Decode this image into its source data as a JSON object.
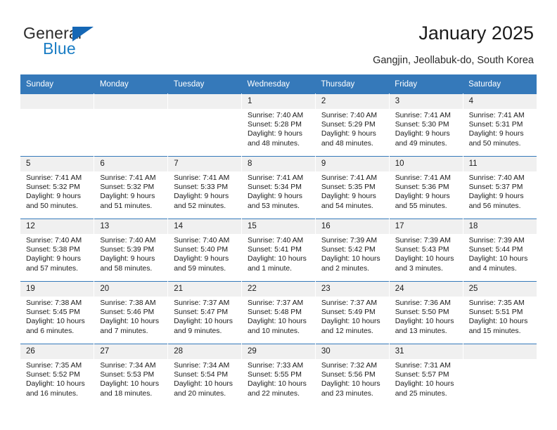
{
  "brand": {
    "name_part1": "General",
    "name_part2": "Blue",
    "triangle_color": "#1567b5",
    "blue_text_color": "#1a7dc4"
  },
  "header": {
    "title": "January 2025",
    "location": "Gangjin, Jeollabuk-do, South Korea"
  },
  "theme": {
    "header_row_bg": "#3579ba",
    "daynum_bg": "#f0f0f0",
    "grid_line": "#3579ba"
  },
  "weekdays": [
    "Sunday",
    "Monday",
    "Tuesday",
    "Wednesday",
    "Thursday",
    "Friday",
    "Saturday"
  ],
  "weeks": [
    [
      {
        "day": "",
        "empty": true
      },
      {
        "day": "",
        "empty": true
      },
      {
        "day": "",
        "empty": true
      },
      {
        "day": "1",
        "sunrise": "Sunrise: 7:40 AM",
        "sunset": "Sunset: 5:28 PM",
        "daylight1": "Daylight: 9 hours",
        "daylight2": "and 48 minutes."
      },
      {
        "day": "2",
        "sunrise": "Sunrise: 7:40 AM",
        "sunset": "Sunset: 5:29 PM",
        "daylight1": "Daylight: 9 hours",
        "daylight2": "and 48 minutes."
      },
      {
        "day": "3",
        "sunrise": "Sunrise: 7:41 AM",
        "sunset": "Sunset: 5:30 PM",
        "daylight1": "Daylight: 9 hours",
        "daylight2": "and 49 minutes."
      },
      {
        "day": "4",
        "sunrise": "Sunrise: 7:41 AM",
        "sunset": "Sunset: 5:31 PM",
        "daylight1": "Daylight: 9 hours",
        "daylight2": "and 50 minutes."
      }
    ],
    [
      {
        "day": "5",
        "sunrise": "Sunrise: 7:41 AM",
        "sunset": "Sunset: 5:32 PM",
        "daylight1": "Daylight: 9 hours",
        "daylight2": "and 50 minutes."
      },
      {
        "day": "6",
        "sunrise": "Sunrise: 7:41 AM",
        "sunset": "Sunset: 5:32 PM",
        "daylight1": "Daylight: 9 hours",
        "daylight2": "and 51 minutes."
      },
      {
        "day": "7",
        "sunrise": "Sunrise: 7:41 AM",
        "sunset": "Sunset: 5:33 PM",
        "daylight1": "Daylight: 9 hours",
        "daylight2": "and 52 minutes."
      },
      {
        "day": "8",
        "sunrise": "Sunrise: 7:41 AM",
        "sunset": "Sunset: 5:34 PM",
        "daylight1": "Daylight: 9 hours",
        "daylight2": "and 53 minutes."
      },
      {
        "day": "9",
        "sunrise": "Sunrise: 7:41 AM",
        "sunset": "Sunset: 5:35 PM",
        "daylight1": "Daylight: 9 hours",
        "daylight2": "and 54 minutes."
      },
      {
        "day": "10",
        "sunrise": "Sunrise: 7:41 AM",
        "sunset": "Sunset: 5:36 PM",
        "daylight1": "Daylight: 9 hours",
        "daylight2": "and 55 minutes."
      },
      {
        "day": "11",
        "sunrise": "Sunrise: 7:40 AM",
        "sunset": "Sunset: 5:37 PM",
        "daylight1": "Daylight: 9 hours",
        "daylight2": "and 56 minutes."
      }
    ],
    [
      {
        "day": "12",
        "sunrise": "Sunrise: 7:40 AM",
        "sunset": "Sunset: 5:38 PM",
        "daylight1": "Daylight: 9 hours",
        "daylight2": "and 57 minutes."
      },
      {
        "day": "13",
        "sunrise": "Sunrise: 7:40 AM",
        "sunset": "Sunset: 5:39 PM",
        "daylight1": "Daylight: 9 hours",
        "daylight2": "and 58 minutes."
      },
      {
        "day": "14",
        "sunrise": "Sunrise: 7:40 AM",
        "sunset": "Sunset: 5:40 PM",
        "daylight1": "Daylight: 9 hours",
        "daylight2": "and 59 minutes."
      },
      {
        "day": "15",
        "sunrise": "Sunrise: 7:40 AM",
        "sunset": "Sunset: 5:41 PM",
        "daylight1": "Daylight: 10 hours",
        "daylight2": "and 1 minute."
      },
      {
        "day": "16",
        "sunrise": "Sunrise: 7:39 AM",
        "sunset": "Sunset: 5:42 PM",
        "daylight1": "Daylight: 10 hours",
        "daylight2": "and 2 minutes."
      },
      {
        "day": "17",
        "sunrise": "Sunrise: 7:39 AM",
        "sunset": "Sunset: 5:43 PM",
        "daylight1": "Daylight: 10 hours",
        "daylight2": "and 3 minutes."
      },
      {
        "day": "18",
        "sunrise": "Sunrise: 7:39 AM",
        "sunset": "Sunset: 5:44 PM",
        "daylight1": "Daylight: 10 hours",
        "daylight2": "and 4 minutes."
      }
    ],
    [
      {
        "day": "19",
        "sunrise": "Sunrise: 7:38 AM",
        "sunset": "Sunset: 5:45 PM",
        "daylight1": "Daylight: 10 hours",
        "daylight2": "and 6 minutes."
      },
      {
        "day": "20",
        "sunrise": "Sunrise: 7:38 AM",
        "sunset": "Sunset: 5:46 PM",
        "daylight1": "Daylight: 10 hours",
        "daylight2": "and 7 minutes."
      },
      {
        "day": "21",
        "sunrise": "Sunrise: 7:37 AM",
        "sunset": "Sunset: 5:47 PM",
        "daylight1": "Daylight: 10 hours",
        "daylight2": "and 9 minutes."
      },
      {
        "day": "22",
        "sunrise": "Sunrise: 7:37 AM",
        "sunset": "Sunset: 5:48 PM",
        "daylight1": "Daylight: 10 hours",
        "daylight2": "and 10 minutes."
      },
      {
        "day": "23",
        "sunrise": "Sunrise: 7:37 AM",
        "sunset": "Sunset: 5:49 PM",
        "daylight1": "Daylight: 10 hours",
        "daylight2": "and 12 minutes."
      },
      {
        "day": "24",
        "sunrise": "Sunrise: 7:36 AM",
        "sunset": "Sunset: 5:50 PM",
        "daylight1": "Daylight: 10 hours",
        "daylight2": "and 13 minutes."
      },
      {
        "day": "25",
        "sunrise": "Sunrise: 7:35 AM",
        "sunset": "Sunset: 5:51 PM",
        "daylight1": "Daylight: 10 hours",
        "daylight2": "and 15 minutes."
      }
    ],
    [
      {
        "day": "26",
        "sunrise": "Sunrise: 7:35 AM",
        "sunset": "Sunset: 5:52 PM",
        "daylight1": "Daylight: 10 hours",
        "daylight2": "and 16 minutes."
      },
      {
        "day": "27",
        "sunrise": "Sunrise: 7:34 AM",
        "sunset": "Sunset: 5:53 PM",
        "daylight1": "Daylight: 10 hours",
        "daylight2": "and 18 minutes."
      },
      {
        "day": "28",
        "sunrise": "Sunrise: 7:34 AM",
        "sunset": "Sunset: 5:54 PM",
        "daylight1": "Daylight: 10 hours",
        "daylight2": "and 20 minutes."
      },
      {
        "day": "29",
        "sunrise": "Sunrise: 7:33 AM",
        "sunset": "Sunset: 5:55 PM",
        "daylight1": "Daylight: 10 hours",
        "daylight2": "and 22 minutes."
      },
      {
        "day": "30",
        "sunrise": "Sunrise: 7:32 AM",
        "sunset": "Sunset: 5:56 PM",
        "daylight1": "Daylight: 10 hours",
        "daylight2": "and 23 minutes."
      },
      {
        "day": "31",
        "sunrise": "Sunrise: 7:31 AM",
        "sunset": "Sunset: 5:57 PM",
        "daylight1": "Daylight: 10 hours",
        "daylight2": "and 25 minutes."
      },
      {
        "day": "",
        "empty": true
      }
    ]
  ]
}
